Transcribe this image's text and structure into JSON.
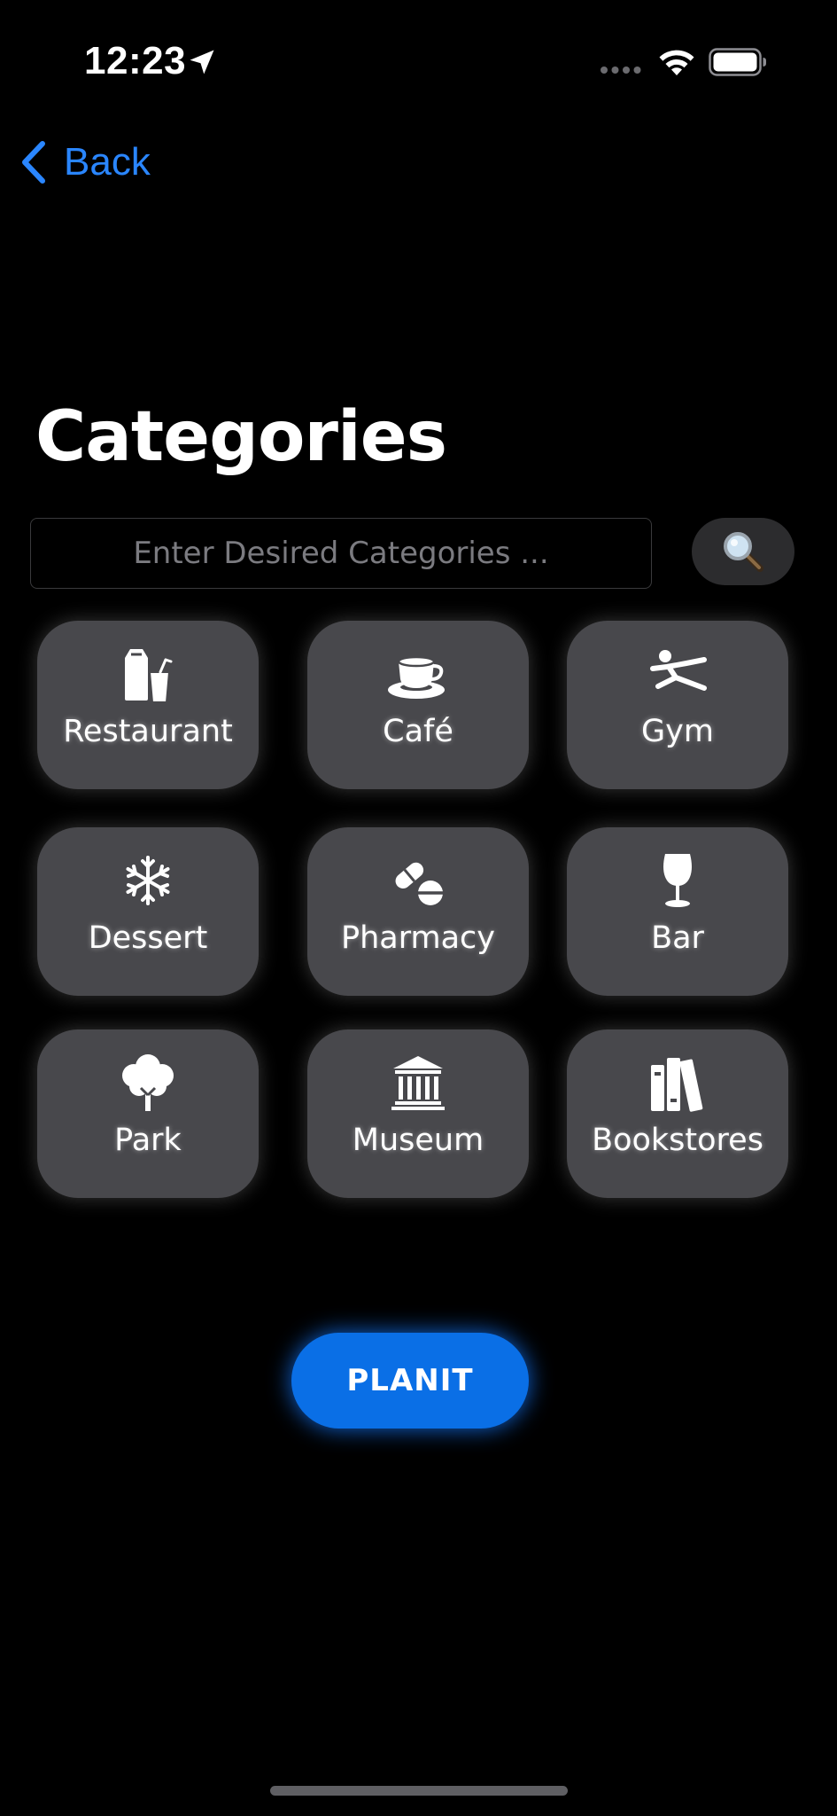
{
  "status_bar": {
    "time": "12:23"
  },
  "nav": {
    "back_label": "Back"
  },
  "page": {
    "title": "Categories"
  },
  "search": {
    "placeholder": "Enter Desired Categories ...",
    "value": ""
  },
  "categories": [
    {
      "label": "Restaurant",
      "icon": "takeout-bag-icon"
    },
    {
      "label": "Café",
      "icon": "coffee-cup-icon"
    },
    {
      "label": "Gym",
      "icon": "figure-stretching-icon"
    },
    {
      "label": "Dessert",
      "icon": "snowflake-icon"
    },
    {
      "label": "Pharmacy",
      "icon": "pills-icon"
    },
    {
      "label": "Bar",
      "icon": "wineglass-icon"
    },
    {
      "label": "Park",
      "icon": "tree-icon"
    },
    {
      "label": "Museum",
      "icon": "building-columns-icon"
    },
    {
      "label": "Bookstores",
      "icon": "books-icon"
    }
  ],
  "action": {
    "planit_label": "PLANIT"
  },
  "colors": {
    "background": "#000000",
    "accent": "#0a6fe6",
    "back_link": "#2a86ff",
    "tile": "#48484c"
  }
}
